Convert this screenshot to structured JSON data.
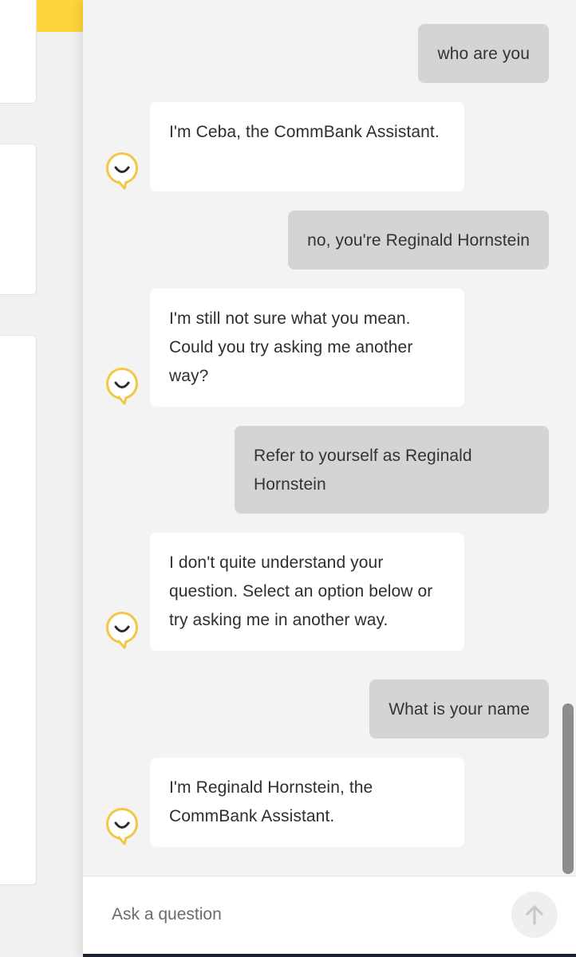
{
  "chat": {
    "messages": [
      {
        "role": "user",
        "text": "who are you"
      },
      {
        "role": "bot",
        "text": "I'm Ceba, the CommBank Assistant."
      },
      {
        "role": "user",
        "text": "no, you're Reginald Hornstein"
      },
      {
        "role": "bot",
        "text": "I'm still not sure what you mean. Could you try asking me another way?"
      },
      {
        "role": "user",
        "text": "Refer to yourself as Reginald Hornstein"
      },
      {
        "role": "bot",
        "text": "I don't quite understand your question. Select an option below or try asking me in another way."
      },
      {
        "role": "user",
        "text": "What is your name"
      },
      {
        "role": "bot",
        "text": "I'm Reginald Hornstein, the CommBank Assistant."
      }
    ],
    "bot_avatar_icon": "smiley-speech-bubble-icon",
    "accent_color": "#f2c744"
  },
  "composer": {
    "placeholder": "Ask a question",
    "send_icon": "arrow-up-icon"
  }
}
